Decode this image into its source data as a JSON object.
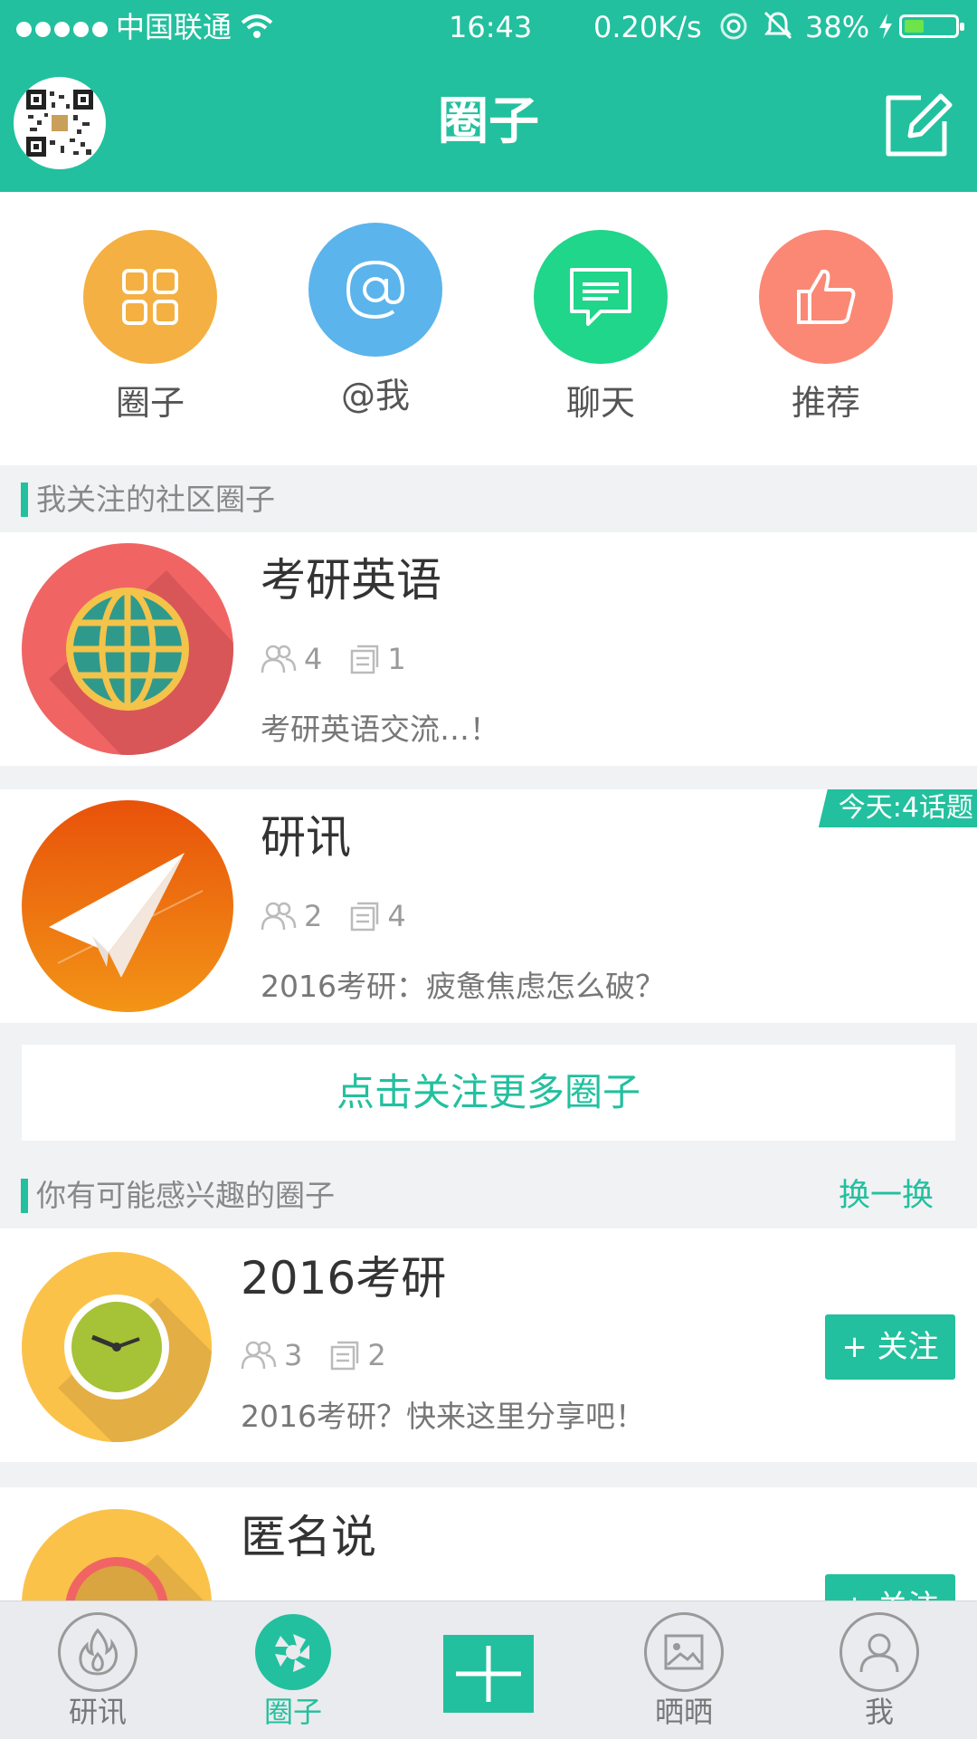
{
  "status_bar": {
    "carrier": "中国联通",
    "time": "16:43",
    "speed": "0.20K/s",
    "battery": "38%",
    "battery_level": 0.38
  },
  "header": {
    "title": "圈子"
  },
  "quick_actions": [
    {
      "label": "圈子",
      "color": "#f4b042",
      "icon": "grid-icon"
    },
    {
      "label": "@我",
      "color": "#5bb4ec",
      "icon": "at-icon"
    },
    {
      "label": "聊天",
      "color": "#1fd68a",
      "icon": "chat-icon"
    },
    {
      "label": "推荐",
      "color": "#fb8874",
      "icon": "thumbs-up-icon"
    }
  ],
  "followed_section": {
    "title": "我关注的社区圈子",
    "items": [
      {
        "name": "考研英语",
        "members": "4",
        "posts": "1",
        "desc": "考研英语交流…！",
        "badge": ""
      },
      {
        "name": "研讯",
        "members": "2",
        "posts": "4",
        "desc": "2016考研：疲惫焦虑怎么破？",
        "badge": "今天:4话题"
      }
    ],
    "more_label": "点击关注更多圈子"
  },
  "suggested_section": {
    "title": "你有可能感兴趣的圈子",
    "refresh_label": "换一换",
    "items": [
      {
        "name": "2016考研",
        "members": "3",
        "posts": "2",
        "desc": "2016考研？快来这里分享吧！",
        "follow_label": "+ 关注"
      },
      {
        "name": "匿名说",
        "follow_label": "+ 关注"
      }
    ]
  },
  "tab_bar": {
    "items": [
      {
        "label": "研讯",
        "icon": "flame-icon",
        "active": false
      },
      {
        "label": "圈子",
        "icon": "aperture-icon",
        "active": true
      },
      {
        "label": "",
        "icon": "plus-icon",
        "active": false
      },
      {
        "label": "晒晒",
        "icon": "image-icon",
        "active": false
      },
      {
        "label": "我",
        "icon": "user-icon",
        "active": false
      }
    ]
  },
  "colors": {
    "accent": "#22c09e",
    "background": "#f1f2f4"
  }
}
